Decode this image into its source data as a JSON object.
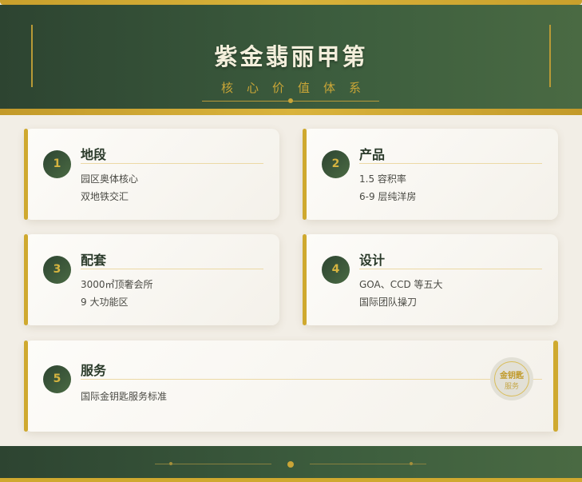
{
  "header": {
    "title": "紫金翡丽甲第",
    "subtitle": "核心价值体系"
  },
  "cards": [
    {
      "num": "1",
      "title": "地段",
      "lines": [
        "园区奥体核心",
        "双地铁交汇"
      ]
    },
    {
      "num": "2",
      "title": "产品",
      "lines": [
        "1.5 容积率",
        "6-9 层纯洋房"
      ]
    },
    {
      "num": "3",
      "title": "配套",
      "lines": [
        "3000㎡顶奢会所",
        "9 大功能区"
      ]
    },
    {
      "num": "4",
      "title": "设计",
      "lines": [
        "GOA、CCD 等五大",
        "国际团队操刀"
      ]
    },
    {
      "num": "5",
      "title": "服务",
      "lines": [
        "国际金钥匙服务标准"
      ]
    }
  ],
  "badge": {
    "line1": "金钥匙",
    "line2": "服务"
  },
  "colors": {
    "green": "#3d5e3e",
    "gold": "#cfa92f",
    "bg": "#f2eee6"
  }
}
